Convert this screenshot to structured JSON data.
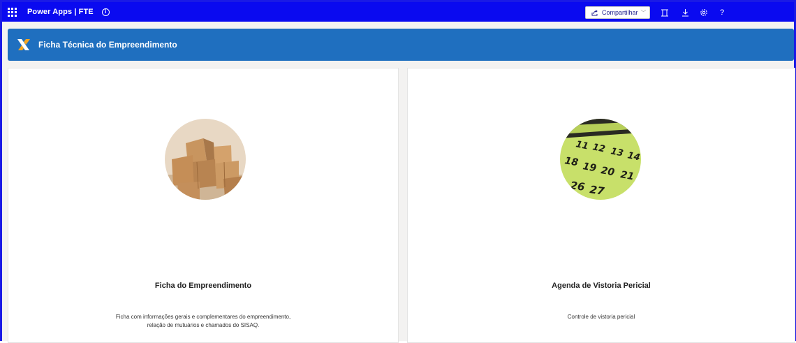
{
  "topbar": {
    "app_title": "Power Apps | FTE",
    "info_icon": "info-icon",
    "share_label": "Compartilhar",
    "icons": [
      "fit-screen-icon",
      "download-icon",
      "settings-icon",
      "help-icon"
    ],
    "help_glyph": "?",
    "color": "#0a0af0"
  },
  "header": {
    "title": "Ficha Técnica do Empreendimento",
    "color": "#1f6fbf"
  },
  "cards": [
    {
      "title": "Ficha do Empreendimento",
      "description_line1": "Ficha com informações gerais e complementares do empreendimento,",
      "description_line2": "relação de mutuários e chamados do SISAQ.",
      "image": "cardboard-boxes-image"
    },
    {
      "title": "Agenda de Vistoria Pericial",
      "description_line1": "Controle de vistoria pericial",
      "image": "calendar-image",
      "calendar_numbers": [
        "11",
        "12",
        "13",
        "14",
        "18",
        "19",
        "20",
        "21",
        "26",
        "27"
      ]
    }
  ]
}
